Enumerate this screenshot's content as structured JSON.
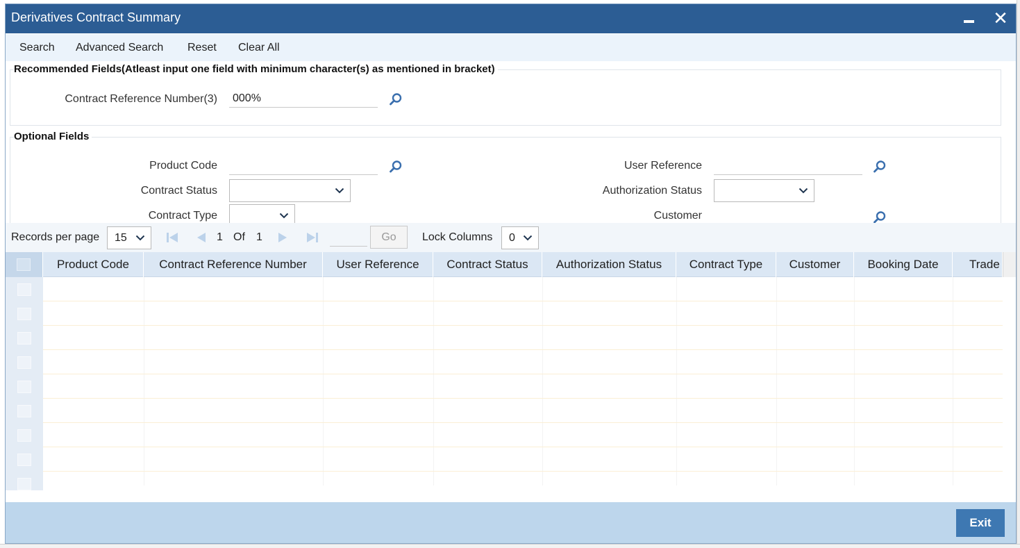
{
  "window": {
    "title": "Derivatives Contract Summary"
  },
  "toolbar": {
    "items": [
      "Search",
      "Advanced Search",
      "Reset",
      "Clear All"
    ]
  },
  "recommended": {
    "title": "Recommended Fields(Atleast input one field with minimum character(s) as mentioned in bracket)",
    "contract_ref_label": "Contract Reference Number(3)",
    "contract_ref_value": "000%"
  },
  "optional": {
    "title": "Optional Fields",
    "product_code_label": "Product Code",
    "product_code_value": "",
    "user_reference_label": "User Reference",
    "user_reference_value": "",
    "contract_status_label": "Contract Status",
    "contract_status_value": "",
    "authorization_status_label": "Authorization Status",
    "authorization_status_value": "",
    "contract_type_label": "Contract Type",
    "contract_type_value": "",
    "customer_label": "Customer",
    "customer_value": ""
  },
  "pager": {
    "records_label": "Records per page",
    "records_value": "15",
    "current_page": "1",
    "of_label": "Of",
    "total_pages": "1",
    "go_label": "Go",
    "lock_label": "Lock Columns",
    "lock_value": "0"
  },
  "grid": {
    "columns": [
      "Product Code",
      "Contract Reference Number",
      "User Reference",
      "Contract Status",
      "Authorization Status",
      "Contract Type",
      "Customer",
      "Booking Date",
      "Trade"
    ]
  },
  "footer": {
    "exit_label": "Exit"
  },
  "colors": {
    "titlebar": "#2c5d94",
    "toolbar": "#ebf3fb",
    "grid_header": "#dbe7f4",
    "footer": "#bdd6ec",
    "exit_button": "#3e78b2",
    "icon": "#3a6fae"
  }
}
